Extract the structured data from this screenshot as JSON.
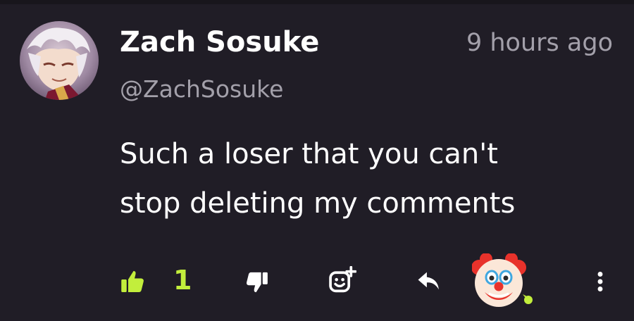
{
  "comment": {
    "author_name": "Zach Sosuke",
    "handle": "@ZachSosuke",
    "timestamp": "9 hours ago",
    "text_line1": "Such a loser that you can't",
    "text_line2": "stop deleting my comments"
  },
  "actions": {
    "like_count": "1",
    "like_icon": "thumbs-up-icon",
    "dislike_icon": "thumbs-down-icon",
    "emoji_icon": "add-emoji-icon",
    "reply_icon": "reply-icon",
    "reaction_emoji": "clown-face-icon",
    "more_icon": "more-vertical-icon"
  },
  "colors": {
    "background": "#201d26",
    "accent": "#c2ee3c",
    "muted_text": "#a3a0aa"
  }
}
